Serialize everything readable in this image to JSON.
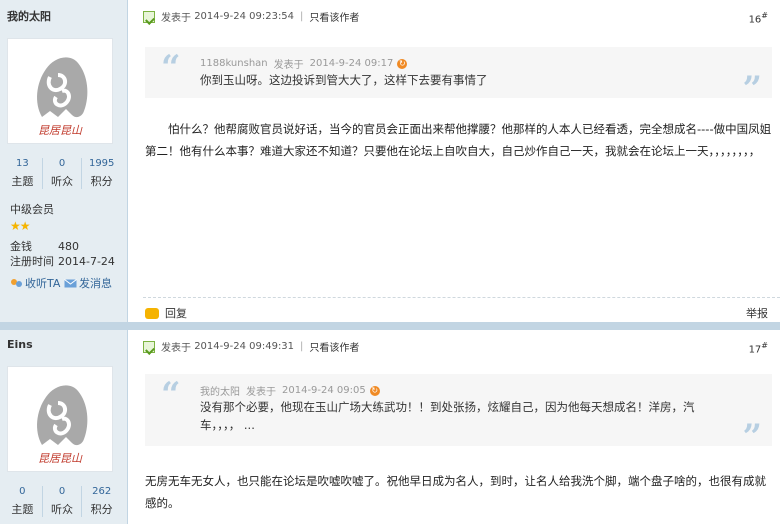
{
  "posts": [
    {
      "author": "我的太阳",
      "stats": [
        {
          "num": "13",
          "label": "主题"
        },
        {
          "num": "0",
          "label": "听众"
        },
        {
          "num": "1995",
          "label": "积分"
        }
      ],
      "group": "中级会员",
      "stars": "★★",
      "money_label": "金钱",
      "money": "480",
      "reg_label": "注册时间",
      "reg_date": "2014-7-24",
      "follow_label": "收听TA",
      "msg_label": "发消息",
      "posted_label": "发表于",
      "posted_time": "2014-9-24 09:23:54",
      "only_author": "只看该作者",
      "floor": "16",
      "quote": {
        "author": "1188kunshan",
        "posted": "发表于",
        "time": "2014-9-24 09:17",
        "text": "你到玉山呀。这边投诉到管大大了，这样下去要有事情了"
      },
      "content": "怕什么？他帮腐败官员说好话，当今的官员会正面出来帮他撑腰？他那样的人本人已经看透，完全想成名----做中国凤姐第二！他有什么本事？难道大家还不知道？只要他在论坛上自吹自大，自己炒作自己一天，我就会在论坛上一天，，，，，，，，",
      "reply_label": "回复",
      "report_label": "举报"
    },
    {
      "author": "Eins",
      "stats": [
        {
          "num": "0",
          "label": "主题"
        },
        {
          "num": "0",
          "label": "听众"
        },
        {
          "num": "262",
          "label": "积分"
        }
      ],
      "posted_label": "发表于",
      "posted_time": "2014-9-24 09:49:31",
      "only_author": "只看该作者",
      "floor": "17",
      "quote": {
        "author": "我的太阳",
        "posted": "发表于",
        "time": "2014-9-24 09:05",
        "text": "没有那个必要，他现在玉山广场大练武功！！到处张扬，炫耀自己，因为他每天想成名！洋房，汽车，，，，  ..."
      },
      "content": "无房无车无女人，也只能在论坛是吹嘘吹嘘了。祝他早日成为名人，到时，让名人给我洗个脚，端个盘子啥的，也很有成就感的。"
    }
  ],
  "avatar_caption": "昆居昆山",
  "colors": {
    "link": "#336699",
    "sidebar": "#e5edf2",
    "separator": "#c2d5e3"
  }
}
